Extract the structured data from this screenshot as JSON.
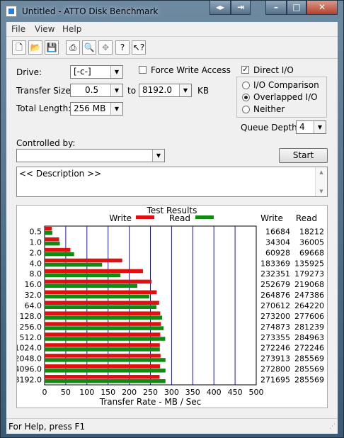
{
  "window": {
    "title": "Untitled - ATTO Disk Benchmark"
  },
  "menu": [
    "File",
    "View",
    "Help"
  ],
  "toolbar_icons": [
    "new-file-icon",
    "open-folder-icon",
    "save-icon",
    "print-icon",
    "print-preview-icon",
    "move-icon",
    "help-icon",
    "context-help-icon"
  ],
  "form": {
    "drive_label": "Drive:",
    "drive_value": "[-c-]",
    "force_write_label": "Force Write Access",
    "direct_io_label": "Direct I/O",
    "transfer_size_label": "Transfer Size:",
    "transfer_from": "0.5",
    "to_label": "to",
    "transfer_to": "8192.0",
    "kb_label": "KB",
    "total_length_label": "Total Length:",
    "total_length_value": "256 MB",
    "io_comparison_label": "I/O Comparison",
    "overlapped_io_label": "Overlapped I/O",
    "neither_label": "Neither",
    "queue_depth_label": "Queue Depth:",
    "queue_depth_value": "4",
    "controlled_by_label": "Controlled by:",
    "controlled_by_value": "",
    "start_label": "Start",
    "description_text": "<< Description >>"
  },
  "status": "For Help, press F1",
  "colors": {
    "write": "#e01010",
    "read": "#108a10",
    "grid": "#1a1a9a"
  },
  "chart_data": {
    "type": "bar",
    "orientation": "horizontal",
    "title": "Test Results",
    "xlabel": "Transfer Rate - MB / Sec",
    "ylabel": "",
    "xlim": [
      0,
      500
    ],
    "xticks": [
      "0",
      "50",
      "100",
      "150",
      "200",
      "250",
      "300",
      "350",
      "400",
      "450",
      "500"
    ],
    "legend": [
      "Write",
      "Read"
    ],
    "legend_position": "top",
    "grid": true,
    "table_headers": [
      "Write",
      "Read"
    ],
    "categories": [
      "0.5",
      "1.0",
      "2.0",
      "4.0",
      "8.0",
      "16.0",
      "32.0",
      "64.0",
      "128.0",
      "256.0",
      "512.0",
      "1024.0",
      "2048.0",
      "4096.0",
      "8192.0"
    ],
    "series": [
      {
        "name": "Write",
        "values": [
          16684,
          34304,
          60928,
          183369,
          232351,
          252679,
          264876,
          270612,
          273200,
          274873,
          273355,
          272246,
          273913,
          272800,
          271695
        ]
      },
      {
        "name": "Read",
        "values": [
          18212,
          36005,
          69668,
          135925,
          179273,
          219068,
          247386,
          264220,
          277606,
          281239,
          284963,
          272246,
          285569,
          285569,
          285569
        ]
      }
    ],
    "display_units_note": "table values in KB/sec; bars drawn in MB/sec"
  }
}
